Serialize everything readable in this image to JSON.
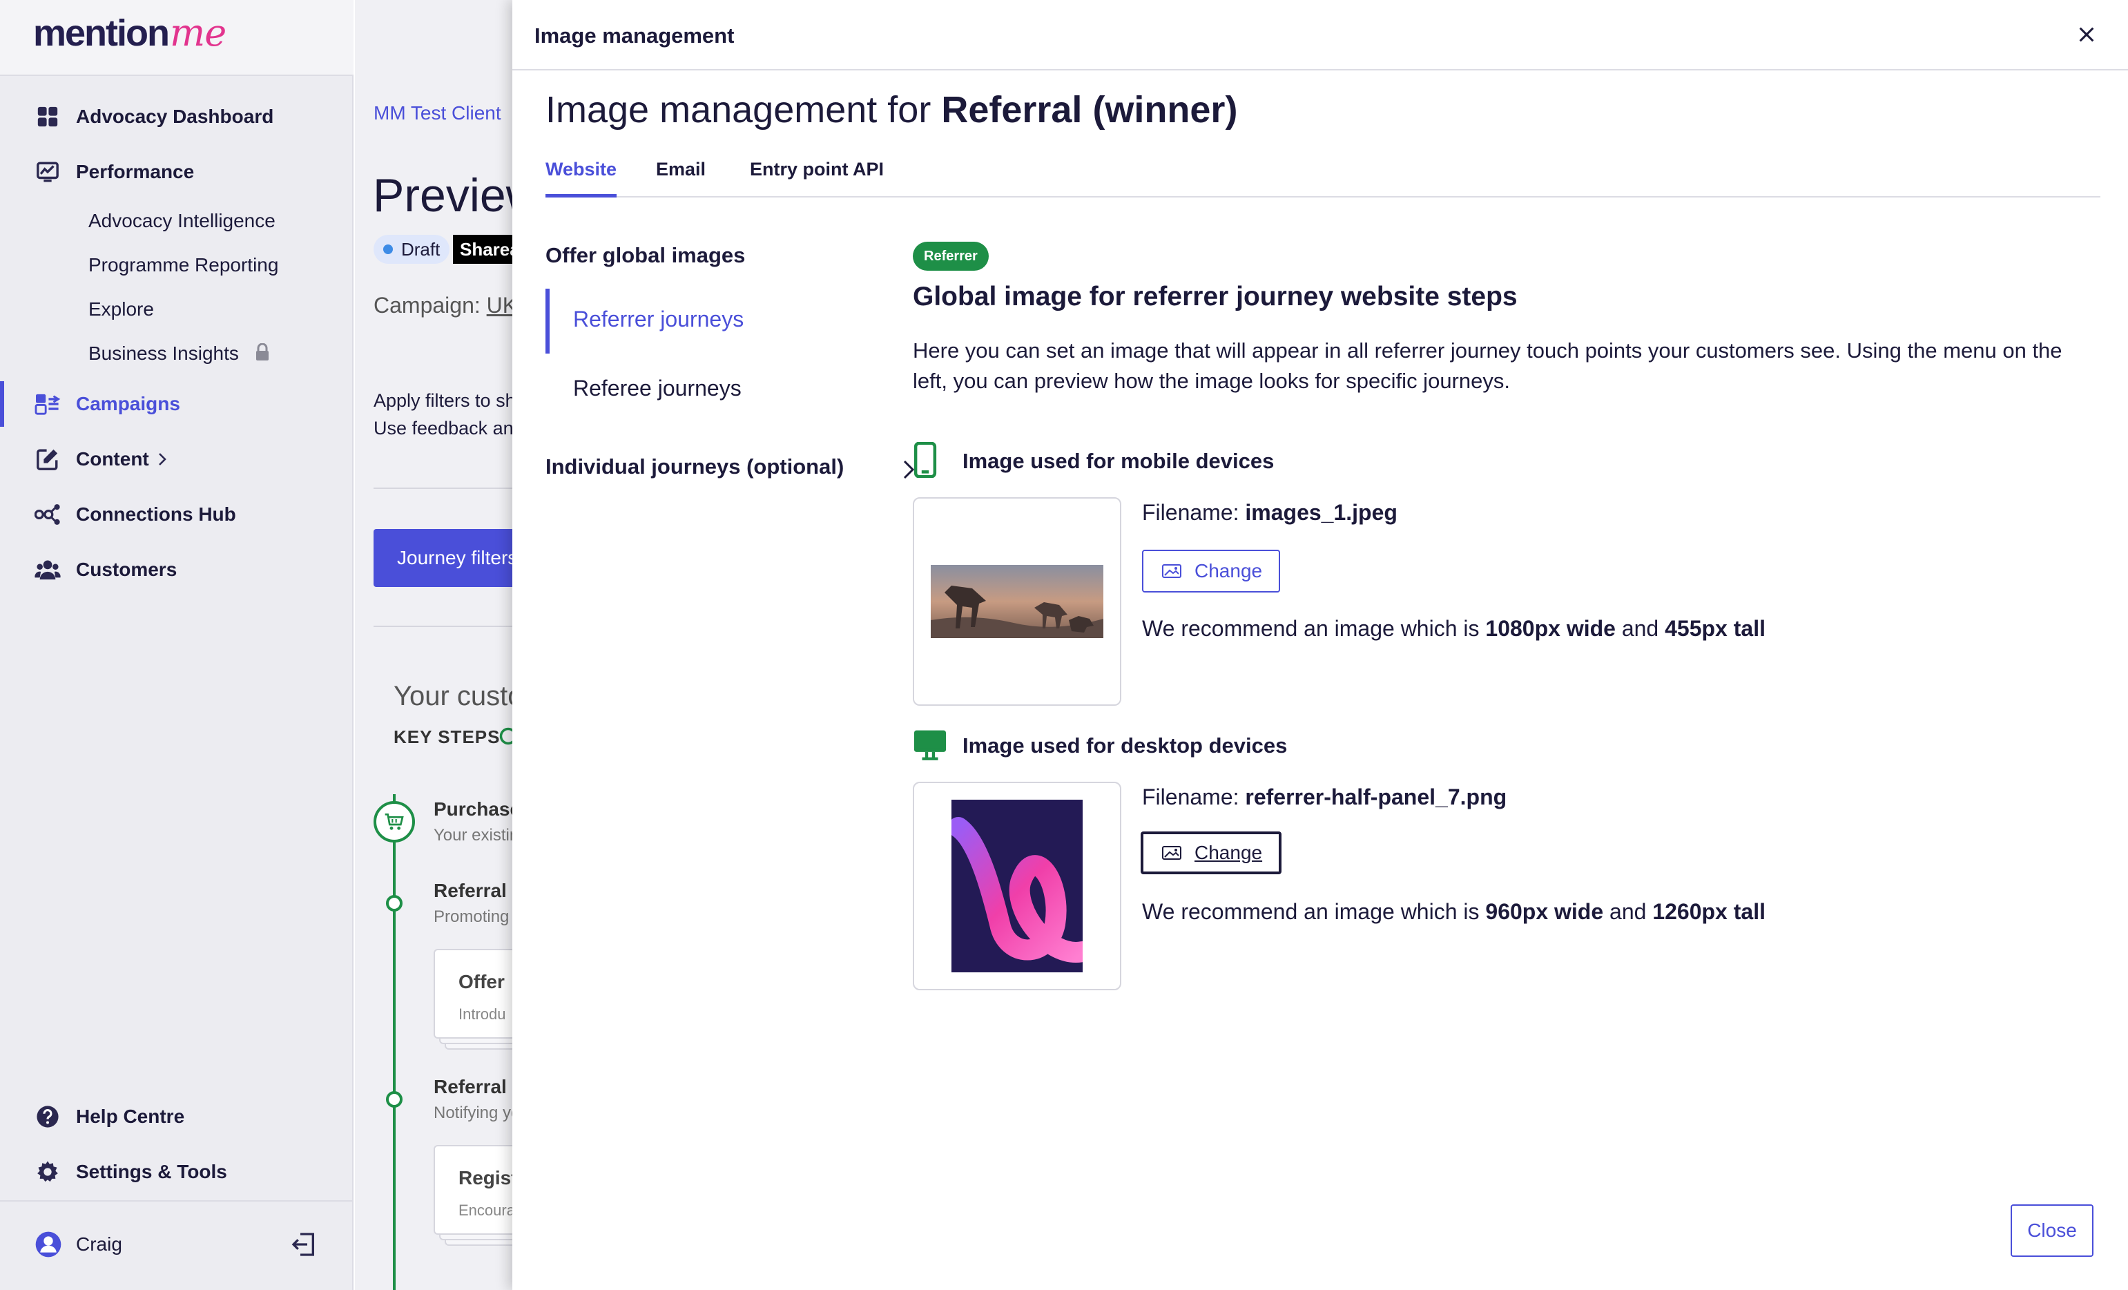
{
  "sidebar": {
    "logo_text": "mention",
    "logo_accent": "me",
    "nav": [
      {
        "label": "Advocacy Dashboard",
        "icon": "dashboard-grid-icon"
      },
      {
        "label": "Performance",
        "icon": "performance-chart-icon"
      },
      {
        "label": "Campaigns",
        "icon": "campaigns-icon"
      },
      {
        "label": "Content",
        "icon": "edit-pencil-icon"
      },
      {
        "label": "Connections Hub",
        "icon": "connections-icon"
      },
      {
        "label": "Customers",
        "icon": "customers-icon"
      }
    ],
    "performance_sub": [
      "Advocacy Intelligence",
      "Programme Reporting",
      "Explore",
      "Business Insights"
    ],
    "bottom": [
      {
        "label": "Help Centre",
        "icon": "help-icon"
      },
      {
        "label": "Settings & Tools",
        "icon": "gear-icon"
      }
    ],
    "user": {
      "name": "Craig"
    }
  },
  "background": {
    "breadcrumb": "MM Test Client",
    "title": "Preview",
    "draft_badge": "Draft",
    "share_badge": "Sharea",
    "campaign_prefix": "Campaign:",
    "campaign_link": "UK",
    "apply_line1": "Apply filters to sh",
    "apply_line2": "Use feedback an",
    "journey_filters_button": "Journey filters",
    "customer_heading": "Your custo",
    "key_steps": "KEY STEPS",
    "steps": [
      {
        "title": "Purchase",
        "subtitle": "Your existin"
      },
      {
        "title": "Referral o",
        "subtitle": "Promoting"
      },
      {
        "title": "Referral e",
        "subtitle": "Notifying yo"
      }
    ],
    "cards": [
      {
        "title": "Offer",
        "subtitle": "Introdu"
      },
      {
        "title": "Regist",
        "subtitle": "Encoura"
      }
    ]
  },
  "modal": {
    "header_title": "Image management",
    "title_prefix": "Image management for",
    "title_bold": "Referral (winner)",
    "tabs": [
      "Website",
      "Email",
      "Entry point API"
    ],
    "left_nav": {
      "heading": "Offer global images",
      "items": [
        "Referrer journeys",
        "Referee journeys"
      ],
      "individual": "Individual journeys (optional)"
    },
    "badge": "Referrer",
    "section_title": "Global image for referrer journey website steps",
    "description": "Here you can set an image that will appear in all referrer journey touch points your customers see. Using the menu on the left, you can preview how the image looks for specific journeys.",
    "mobile": {
      "label": "Image used for mobile devices",
      "filename_prefix": "Filename:",
      "filename": "images_1.jpeg",
      "change": "Change",
      "rec_prefix": "We recommend an image which is",
      "rec_width": "1080px wide",
      "rec_and": "and",
      "rec_height": "455px tall"
    },
    "desktop": {
      "label": "Image used for desktop devices",
      "filename_prefix": "Filename:",
      "filename": "referrer-half-panel_7.png",
      "change": "Change",
      "rec_prefix": "We recommend an image which is",
      "rec_width": "960px wide",
      "rec_and": "and",
      "rec_height": "1260px tall"
    },
    "close_button": "Close"
  },
  "colors": {
    "accent": "#4a4fd9",
    "success_green": "#1e8f47",
    "brand_pink": "#e2348e",
    "text_dark": "#1c1a3a"
  }
}
